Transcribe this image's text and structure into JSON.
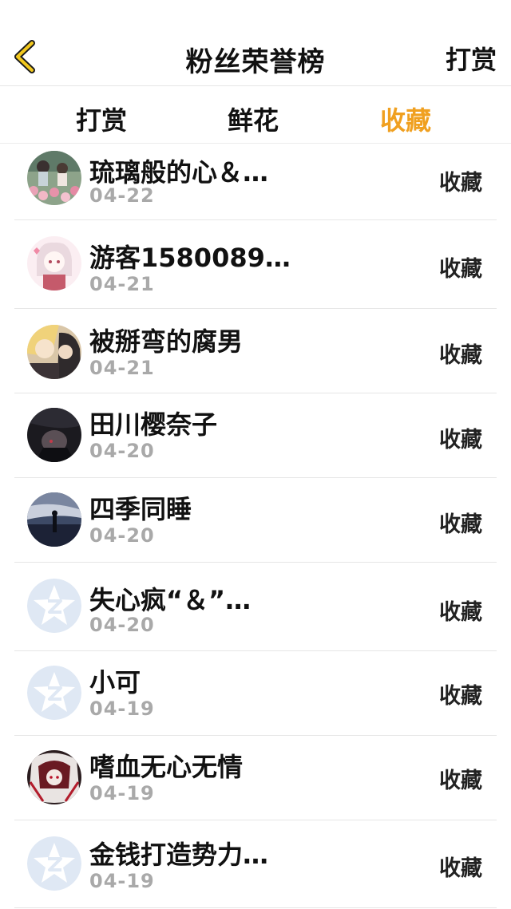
{
  "header": {
    "title": "粉丝荣誉榜",
    "action_label": "打赏",
    "back_icon": "chevron-left-icon",
    "accent_color": "#f0a020"
  },
  "tabs": [
    {
      "label": "打赏",
      "active": false
    },
    {
      "label": "鲜花",
      "active": false
    },
    {
      "label": "收藏",
      "active": true
    }
  ],
  "rows": [
    {
      "name": "琉璃般的心＆…",
      "date": "04-22",
      "action": "收藏",
      "avatar": "photo-flowers"
    },
    {
      "name": "游客1580089…",
      "date": "04-21",
      "action": "收藏",
      "avatar": "anime-girl-pink"
    },
    {
      "name": "被掰弯的腐男",
      "date": "04-21",
      "action": "收藏",
      "avatar": "anime-couple"
    },
    {
      "name": "田川樱奈子",
      "date": "04-20",
      "action": "收藏",
      "avatar": "dark-anime"
    },
    {
      "name": "四季同睡",
      "date": "04-20",
      "action": "收藏",
      "avatar": "sky-silhouette"
    },
    {
      "name": "失心疯“＆”…",
      "date": "04-20",
      "action": "收藏",
      "avatar": "default-star"
    },
    {
      "name": "小可",
      "date": "04-19",
      "action": "收藏",
      "avatar": "default-star"
    },
    {
      "name": "嗜血无心无情",
      "date": "04-19",
      "action": "收藏",
      "avatar": "red-anime"
    },
    {
      "name": "金钱打造势力…",
      "date": "04-19",
      "action": "收藏",
      "avatar": "default-star"
    }
  ]
}
